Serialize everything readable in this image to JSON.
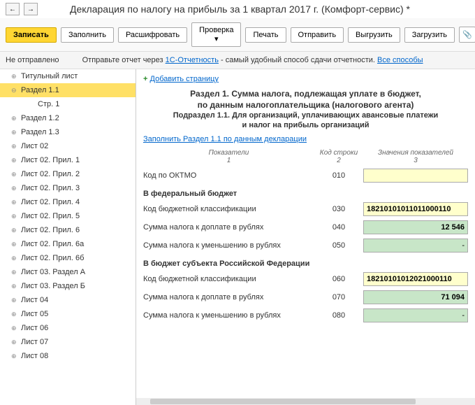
{
  "nav": {
    "back": "←",
    "forward": "→"
  },
  "title": "Декларация по налогу на прибыль за 1 квартал 2017 г. (Комфорт-сервис) *",
  "toolbar": {
    "write": "Записать",
    "fill": "Заполнить",
    "decode": "Расшифровать",
    "check": "Проверка ▾",
    "print": "Печать",
    "send": "Отправить",
    "upload": "Выгрузить",
    "load": "Загрузить",
    "attach": "📎"
  },
  "status": {
    "label": "Не отправлено",
    "text1": "Отправьте отчет через ",
    "link1": "1С-Отчетность",
    "text2": " - самый удобный способ сдачи отчетности. ",
    "link2": "Все способы"
  },
  "tree": {
    "items": [
      {
        "label": "Титульный лист"
      },
      {
        "label": "Раздел 1.1",
        "selected": true
      },
      {
        "label": "Стр. 1",
        "child": true
      },
      {
        "label": "Раздел 1.2"
      },
      {
        "label": "Раздел 1.3"
      },
      {
        "label": "Лист 02"
      },
      {
        "label": "Лист 02. Прил. 1"
      },
      {
        "label": "Лист 02. Прил. 2"
      },
      {
        "label": "Лист 02. Прил. 3"
      },
      {
        "label": "Лист 02. Прил. 4"
      },
      {
        "label": "Лист 02. Прил. 5"
      },
      {
        "label": "Лист 02. Прил. 6"
      },
      {
        "label": "Лист 02. Прил. 6а"
      },
      {
        "label": "Лист 02. Прил. 6б"
      },
      {
        "label": "Лист 03. Раздел А"
      },
      {
        "label": "Лист 03. Раздел Б"
      },
      {
        "label": "Лист 04"
      },
      {
        "label": "Лист 05"
      },
      {
        "label": "Лист 06"
      },
      {
        "label": "Лист 07"
      },
      {
        "label": "Лист 08"
      }
    ]
  },
  "content": {
    "add_page": "Добавить страницу",
    "title1": "Раздел 1. Сумма налога, подлежащая уплате в бюджет,",
    "title2": "по данным налогоплательщика (налогового агента)",
    "sub1": "Подраздел 1.1. Для организаций, уплачивающих авансовые платежи",
    "sub2": "и налог на прибыль организаций",
    "fill_link": "Заполнить Раздел 1.1 по данным декларации",
    "head": {
      "c1a": "Показатели",
      "c1b": "1",
      "c2a": "Код строки",
      "c2b": "2",
      "c3a": "Значения показателей",
      "c3b": "3"
    },
    "rows": {
      "oktmo": {
        "label": "Код по ОКТМО",
        "code": "010",
        "value": ""
      },
      "fed_header": "В федеральный бюджет",
      "fed_kbk": {
        "label": "Код бюджетной классификации",
        "code": "030",
        "value": "18210101011011000110"
      },
      "fed_plus": {
        "label": "Сумма налога к доплате в рублях",
        "code": "040",
        "value": "12 546"
      },
      "fed_minus": {
        "label": "Сумма налога к уменьшению в рублях",
        "code": "050",
        "value": "-"
      },
      "sub_header": "В бюджет субъекта Российской Федерации",
      "sub_kbk": {
        "label": "Код бюджетной классификации",
        "code": "060",
        "value": "18210101012021000110"
      },
      "sub_plus": {
        "label": "Сумма налога к доплате в рублях",
        "code": "070",
        "value": "71 094"
      },
      "sub_minus": {
        "label": "Сумма налога к уменьшению в рублях",
        "code": "080",
        "value": "-"
      }
    }
  }
}
